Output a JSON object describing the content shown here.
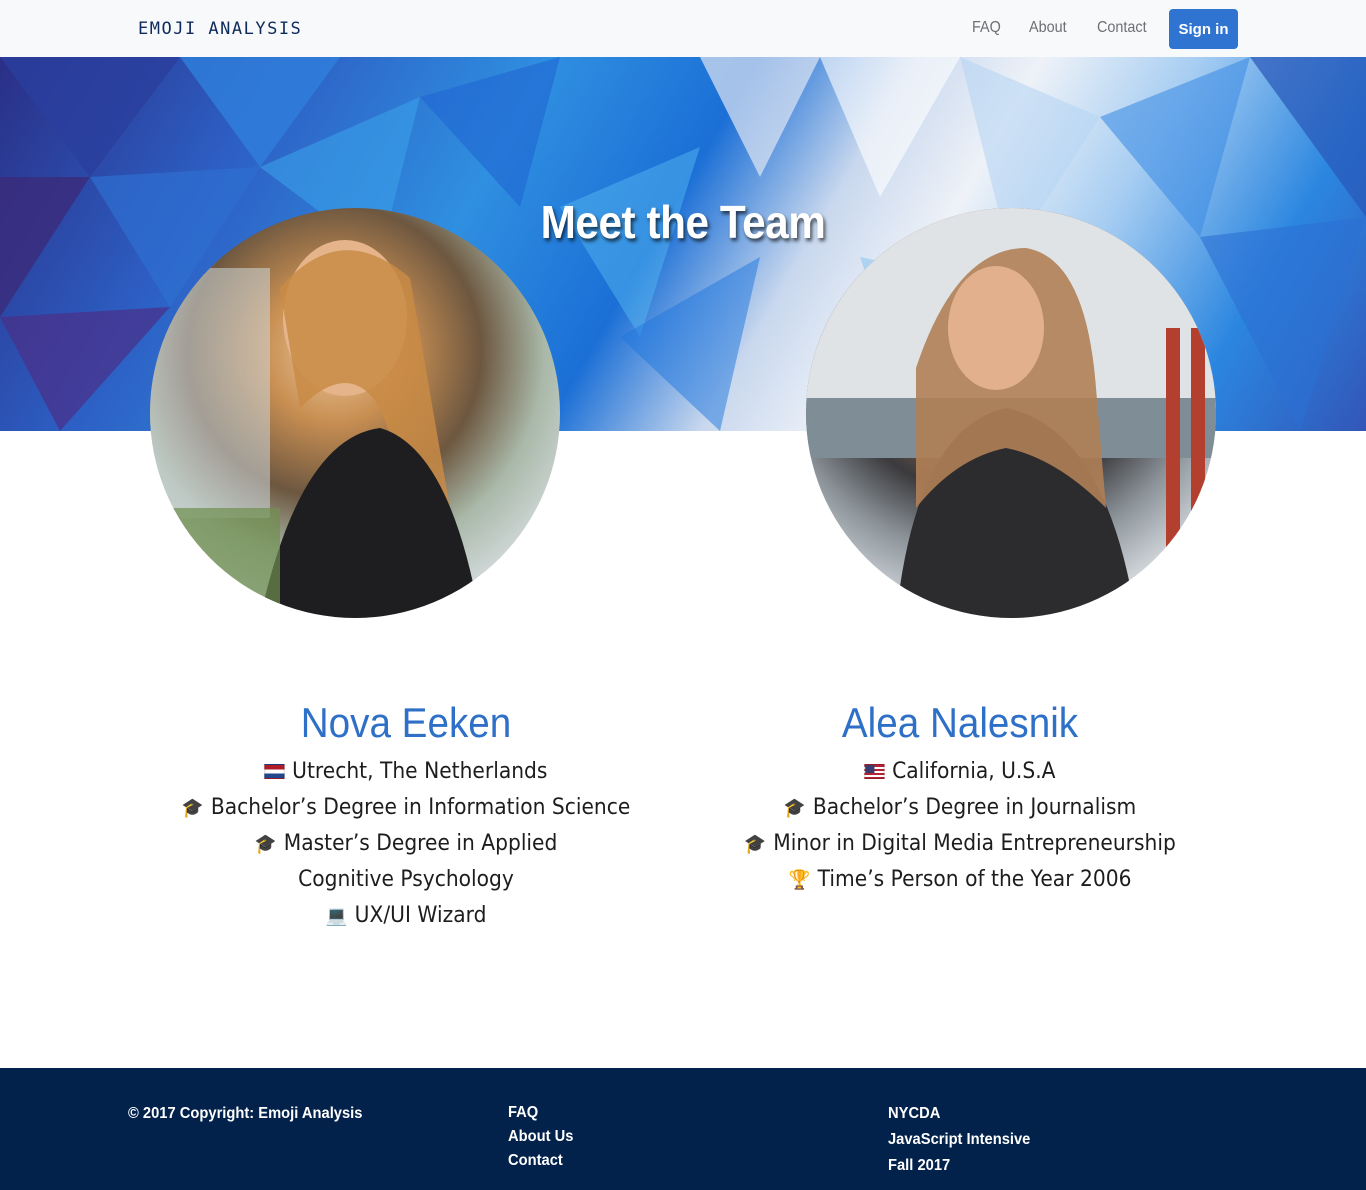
{
  "navbar": {
    "brand": "EMOJI ANALYSIS",
    "links": [
      "FAQ",
      "About",
      "Contact"
    ],
    "signin_label": "Sign in"
  },
  "hero": {
    "title": "Meet the Team"
  },
  "members": [
    {
      "name": "Nova Eeken",
      "details": [
        {
          "icon": "netherlands-flag-icon",
          "text": "Utrecht, The Netherlands"
        },
        {
          "icon": "graduation-cap-icon",
          "text": "Bachelor’s Degree in Information Science"
        },
        {
          "icon": "graduation-cap-icon",
          "text": "Master’s Degree in Applied Cognitive Psychology"
        },
        {
          "icon": "laptop-icon",
          "text": "UX/UI Wizard"
        }
      ]
    },
    {
      "name": "Alea Nalesnik",
      "details": [
        {
          "icon": "usa-flag-icon",
          "text": "California, U.S.A"
        },
        {
          "icon": "graduation-cap-icon",
          "text": "Bachelor’s Degree in Journalism"
        },
        {
          "icon": "graduation-cap-icon",
          "text": "Minor in Digital Media Entrepreneurship"
        },
        {
          "icon": "trophy-icon",
          "text": "Time’s Person of the Year 2006"
        }
      ]
    }
  ],
  "footer": {
    "copyright": "© 2017 Copyright: Emoji Analysis",
    "links": [
      "FAQ",
      "About Us",
      "Contact"
    ],
    "info": [
      "NYCDA",
      "JavaScript Intensive",
      "Fall 2017"
    ]
  },
  "colors": {
    "accent": "#2f74d0",
    "name_blue": "#2e6fc7",
    "footer_bg": "#02214b",
    "navbar_bg": "#f8f9fa"
  }
}
